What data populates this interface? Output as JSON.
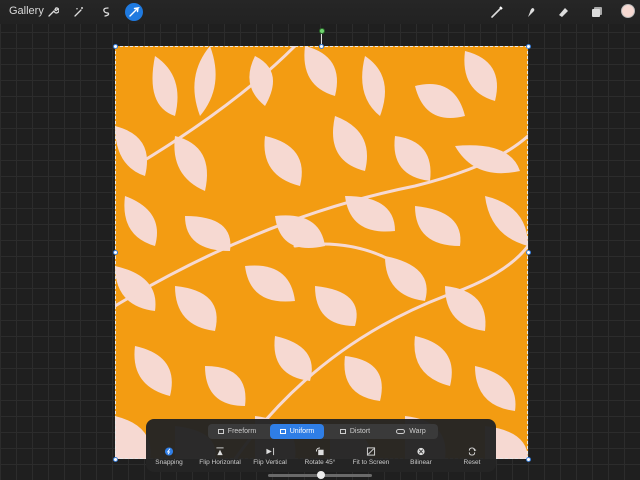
{
  "topbar": {
    "gallery_label": "Gallery",
    "left_tools": [
      "wrench-icon",
      "magic-wand-icon",
      "selection-icon",
      "transform-icon"
    ],
    "right_tools": [
      "brush-icon",
      "smudge-icon",
      "eraser-icon",
      "layers-icon"
    ],
    "active_tool": "transform-icon",
    "current_color": "#f6d9d2"
  },
  "canvas": {
    "background_color": "#f39c12",
    "leaf_color": "#f6d9d2"
  },
  "transform_panel": {
    "modes": [
      {
        "label": "Freeform",
        "icon": "freeform-icon",
        "selected": false
      },
      {
        "label": "Uniform",
        "icon": "uniform-icon",
        "selected": true
      },
      {
        "label": "Distort",
        "icon": "distort-icon",
        "selected": false
      },
      {
        "label": "Warp",
        "icon": "warp-icon",
        "selected": false
      }
    ],
    "options": [
      {
        "label": "Snapping",
        "icon": "snapping-icon"
      },
      {
        "label": "Flip Horizontal",
        "icon": "flip-horizontal-icon"
      },
      {
        "label": "Flip Vertical",
        "icon": "flip-vertical-icon"
      },
      {
        "label": "Rotate 45°",
        "icon": "rotate-icon"
      },
      {
        "label": "Fit to Screen",
        "icon": "fit-screen-icon"
      },
      {
        "label": "Bilinear",
        "icon": "bilinear-icon"
      },
      {
        "label": "Reset",
        "icon": "reset-icon"
      }
    ],
    "accent_color": "#2f7ee6"
  }
}
